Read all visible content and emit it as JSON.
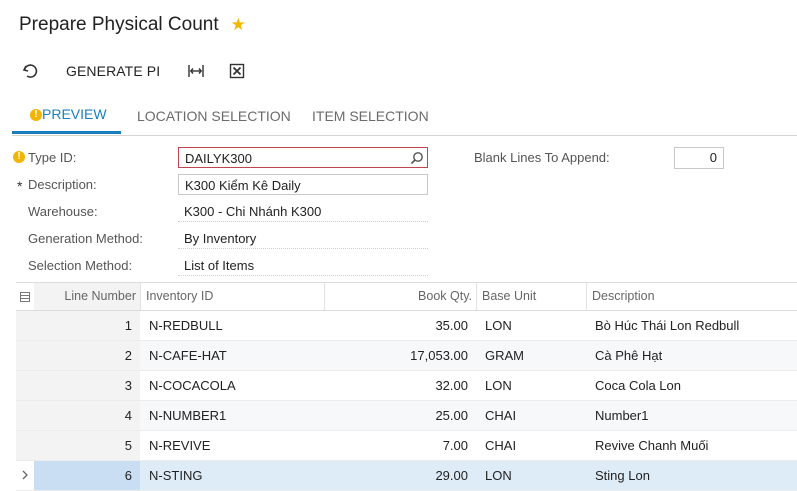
{
  "header": {
    "title": "Prepare Physical Count",
    "favorite_icon": "star-icon",
    "favorite_color": "#f2b800"
  },
  "toolbar": {
    "undo_icon": "undo-icon",
    "generate_label": "GENERATE PI",
    "fit_icon": "fit-columns-icon",
    "export_icon": "export-excel-icon"
  },
  "tabs": [
    {
      "label": "PREVIEW",
      "active": true,
      "has_warning": true
    },
    {
      "label": "LOCATION SELECTION",
      "active": false
    },
    {
      "label": "ITEM SELECTION",
      "active": false
    }
  ],
  "form": {
    "type_id_label": "Type ID:",
    "type_id_value": "DAILYK300",
    "description_label": "Description:",
    "description_value": "K300 Kiểm Kê Daily",
    "warehouse_label": "Warehouse:",
    "warehouse_value": "K300 - Chi Nhánh K300",
    "generation_label": "Generation Method:",
    "generation_value": "By Inventory",
    "selection_label": "Selection Method:",
    "selection_value": "List of Items",
    "blank_lines_label": "Blank Lines To Append:",
    "blank_lines_value": "0"
  },
  "grid": {
    "columns": [
      "Line Number",
      "Inventory ID",
      "Book Qty.",
      "Base Unit",
      "Description"
    ],
    "rows": [
      {
        "line": "1",
        "inventory_id": "N-REDBULL",
        "book_qty": "35.00",
        "unit": "LON",
        "description": "Bò Húc Thái Lon Redbull"
      },
      {
        "line": "2",
        "inventory_id": "N-CAFE-HAT",
        "book_qty": "17,053.00",
        "unit": "GRAM",
        "description": "Cà Phê Hạt"
      },
      {
        "line": "3",
        "inventory_id": "N-COCACOLA",
        "book_qty": "32.00",
        "unit": "LON",
        "description": "Coca Cola Lon"
      },
      {
        "line": "4",
        "inventory_id": "N-NUMBER1",
        "book_qty": "25.00",
        "unit": "CHAI",
        "description": "Number1"
      },
      {
        "line": "5",
        "inventory_id": "N-REVIVE",
        "book_qty": "7.00",
        "unit": "CHAI",
        "description": "Revive Chanh Muối"
      },
      {
        "line": "6",
        "inventory_id": "N-STING",
        "book_qty": "29.00",
        "unit": "LON",
        "description": "Sting Lon"
      }
    ]
  },
  "colors": {
    "accent": "#1a7fc0",
    "warning": "#f4b400",
    "error_border": "#c0454f",
    "selected_row": "#deecf8"
  }
}
